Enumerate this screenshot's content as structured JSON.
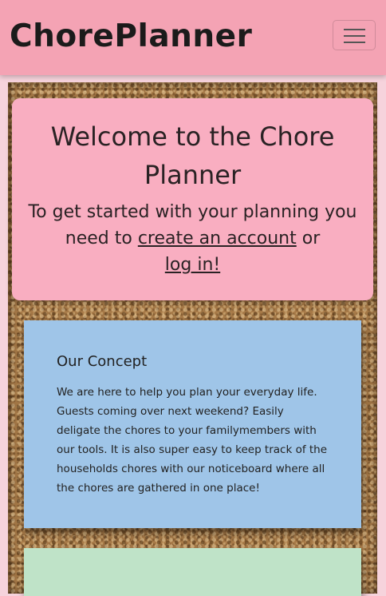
{
  "navbar": {
    "brand": "ChorePlanner",
    "toggler_icon": "hamburger-menu-icon"
  },
  "welcome": {
    "title": "Welcome to the Chore Planner",
    "text_before": "To get started with your planning you need to ",
    "create_account_link": "create an account",
    "text_middle": " or ",
    "login_link": "log in!"
  },
  "concept": {
    "title": "Our Concept",
    "body": "We are here to help you plan your everyday life. Guests coming over next weekend? Easily deligate the chores to your familymembers with our tools. It is also super easy to keep track of the households chores with our noticeboard where all the chores are gathered in one place!"
  },
  "colors": {
    "navbar": "#f4a3b4",
    "welcome_card": "#f9aec1",
    "concept_card": "#9fc5e8",
    "next_card": "#bfe3c8",
    "board": "#a77a48"
  }
}
